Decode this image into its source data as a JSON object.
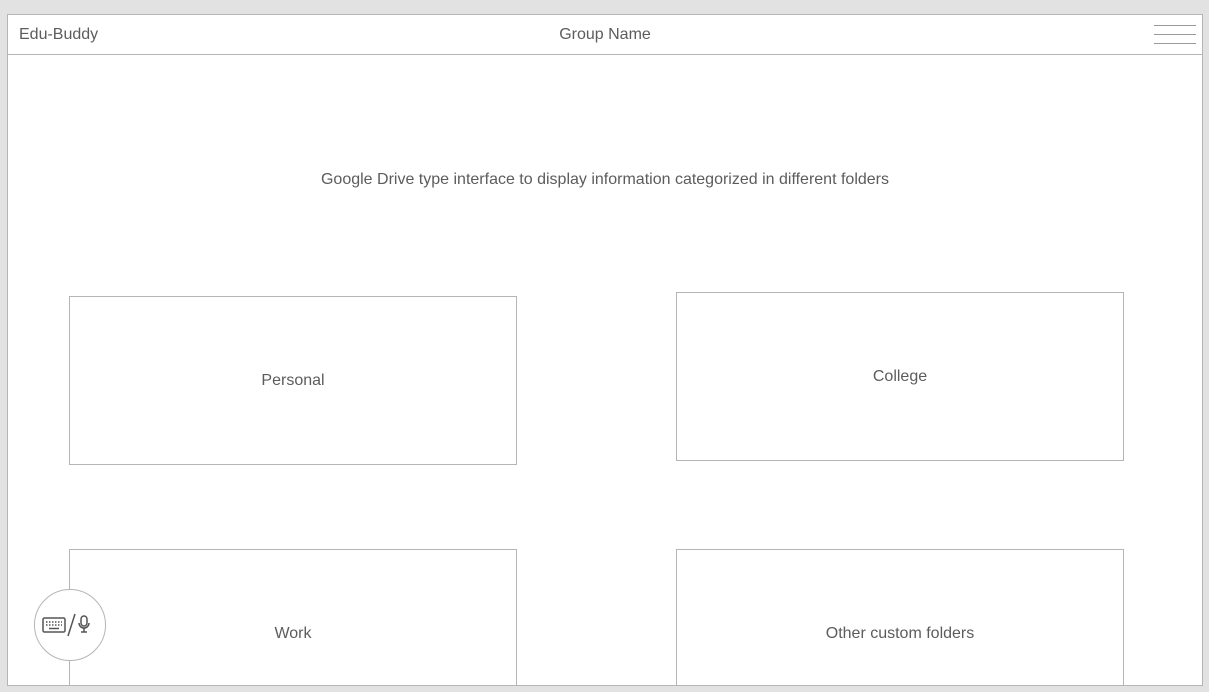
{
  "header": {
    "app_name": "Edu-Buddy",
    "group_name": "Group Name",
    "menu_icon": "hamburger-menu-icon"
  },
  "main": {
    "description": "Google Drive type interface to display information categorized in different folders",
    "folders": [
      {
        "label": "Personal"
      },
      {
        "label": "College"
      },
      {
        "label": "Work"
      },
      {
        "label": "Other custom folders"
      }
    ]
  },
  "input_toggle": {
    "icons": [
      "keyboard-icon",
      "microphone-icon"
    ]
  },
  "colors": {
    "background": "#e2e2e2",
    "surface": "#ffffff",
    "border": "#b5b5b5",
    "text": "#5c5c5c"
  }
}
